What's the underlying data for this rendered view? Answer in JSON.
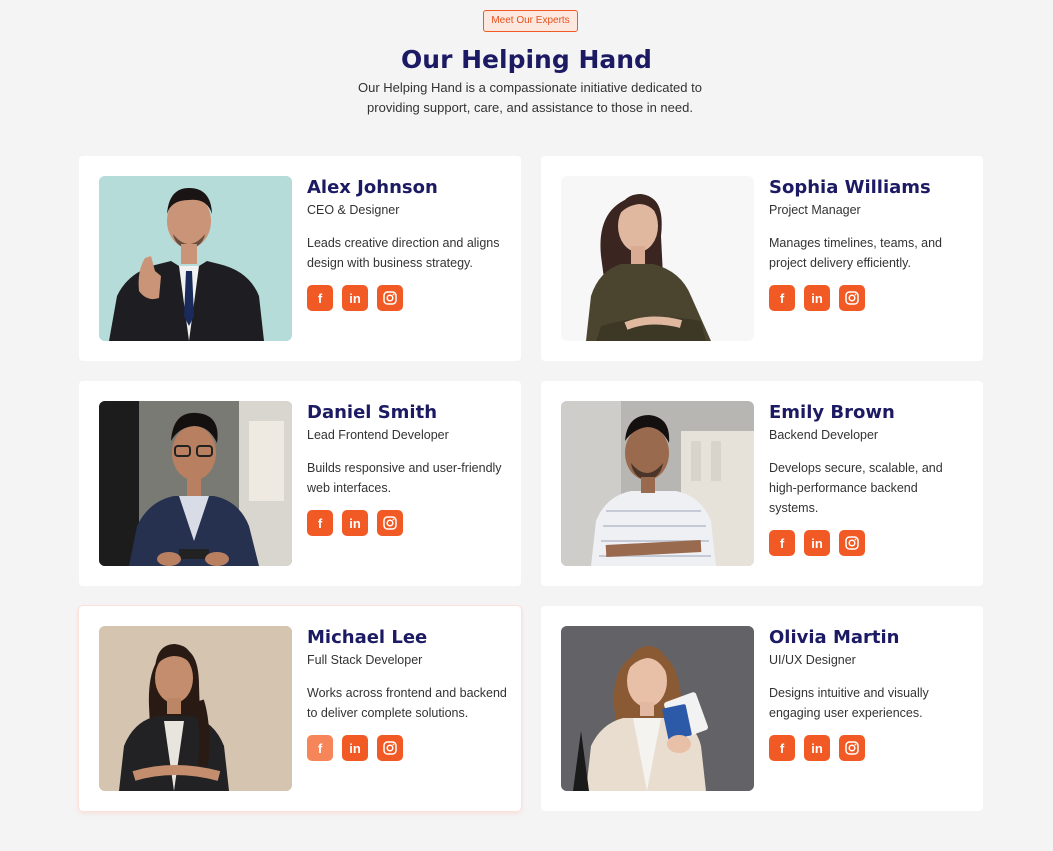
{
  "header": {
    "badge": "Meet Our Experts",
    "title": "Our Helping Hand",
    "subtitle": "Our Helping Hand is a compassionate initiative dedicated to providing support, care, and assistance to those in need."
  },
  "members": [
    {
      "name": "Alex Johnson",
      "role": "CEO & Designer",
      "desc": "Leads creative direction and aligns design with business strategy."
    },
    {
      "name": "Sophia Williams",
      "role": "Project Manager",
      "desc": "Manages timelines, teams, and project delivery efficiently."
    },
    {
      "name": "Daniel Smith",
      "role": "Lead Frontend Developer",
      "desc": "Builds responsive and user-friendly web interfaces."
    },
    {
      "name": "Emily Brown",
      "role": "Backend Developer",
      "desc": "Develops secure, scalable, and high-performance backend systems."
    },
    {
      "name": "Michael Lee",
      "role": "Full Stack Developer",
      "desc": "Works across frontend and backend to deliver complete solutions."
    },
    {
      "name": "Olivia Martin",
      "role": "UI/UX Designer",
      "desc": "Designs intuitive and visually engaging user experiences."
    }
  ],
  "socials": {
    "facebook": "f",
    "linkedin": "in"
  },
  "colors": {
    "accent": "#f15a24",
    "heading": "#1c1a63",
    "background": "#f4f4f5"
  },
  "icons": [
    "facebook-icon",
    "linkedin-icon",
    "instagram-icon"
  ]
}
